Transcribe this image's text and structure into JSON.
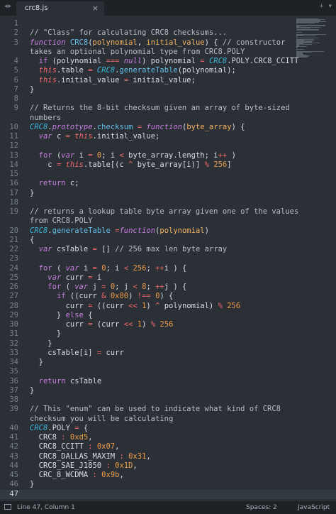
{
  "tab": {
    "title": "crc8.js",
    "close_glyph": "×"
  },
  "status": {
    "position": "Line 47, Column 1",
    "indent": "Spaces: 2",
    "syntax": "JavaScript"
  },
  "gutter": {
    "current_line": "47",
    "lines": [
      "1",
      "2",
      "3",
      "",
      "4",
      "5",
      "6",
      "7",
      "8",
      "9",
      "",
      "10",
      "11",
      "12",
      "13",
      "14",
      "15",
      "16",
      "17",
      "18",
      "19",
      "",
      "20",
      "21",
      "22",
      "23",
      "24",
      "25",
      "26",
      "27",
      "28",
      "29",
      "30",
      "31",
      "32",
      "33",
      "34",
      "35",
      "36",
      "37",
      "38",
      "39",
      "",
      "40",
      "41",
      "42",
      "43",
      "44",
      "45",
      "46",
      "47"
    ]
  },
  "code": {
    "lines": [
      [],
      [
        {
          "t": "// \"Class\" for calculating CRC8 checksums...",
          "c": "cmt"
        }
      ],
      [
        {
          "t": "function",
          "c": "kw"
        },
        {
          "t": " "
        },
        {
          "t": "CRC8",
          "c": "fn"
        },
        {
          "t": "("
        },
        {
          "t": "polynomial",
          "c": "prm"
        },
        {
          "t": ", "
        },
        {
          "t": "initial_value",
          "c": "prm"
        },
        {
          "t": ") { "
        },
        {
          "t": "// constructor",
          "c": "cmt"
        }
      ],
      [
        {
          "t": "takes an optional polynomial type from CRC8.POLY",
          "c": "cmt"
        }
      ],
      [
        {
          "t": "  "
        },
        {
          "t": "if",
          "c": "ctl"
        },
        {
          "t": " (polynomial "
        },
        {
          "t": "===",
          "c": "op"
        },
        {
          "t": " "
        },
        {
          "t": "null",
          "c": "kw"
        },
        {
          "t": ") polynomial "
        },
        {
          "t": "=",
          "c": "op"
        },
        {
          "t": " "
        },
        {
          "t": "CRC8",
          "c": "cls"
        },
        {
          "t": ".POLY.CRC8_CCITT"
        }
      ],
      [
        {
          "t": "  "
        },
        {
          "t": "this",
          "c": "this"
        },
        {
          "t": ".table "
        },
        {
          "t": "=",
          "c": "op"
        },
        {
          "t": " "
        },
        {
          "t": "CRC8",
          "c": "cls"
        },
        {
          "t": "."
        },
        {
          "t": "generateTable",
          "c": "fn"
        },
        {
          "t": "(polynomial);"
        }
      ],
      [
        {
          "t": "  "
        },
        {
          "t": "this",
          "c": "this"
        },
        {
          "t": ".initial_value "
        },
        {
          "t": "=",
          "c": "op"
        },
        {
          "t": " initial_value;"
        }
      ],
      [
        {
          "t": "}"
        }
      ],
      [],
      [
        {
          "t": "// Returns the 8-bit checksum given an array of byte-sized",
          "c": "cmt"
        }
      ],
      [
        {
          "t": "numbers",
          "c": "cmt"
        }
      ],
      [
        {
          "t": "CRC8",
          "c": "cls"
        },
        {
          "t": "."
        },
        {
          "t": "prototype",
          "c": "kw"
        },
        {
          "t": "."
        },
        {
          "t": "checksum",
          "c": "fn"
        },
        {
          "t": " "
        },
        {
          "t": "=",
          "c": "op"
        },
        {
          "t": " "
        },
        {
          "t": "function",
          "c": "kw"
        },
        {
          "t": "("
        },
        {
          "t": "byte_array",
          "c": "prm"
        },
        {
          "t": ") {"
        }
      ],
      [
        {
          "t": "  "
        },
        {
          "t": "var",
          "c": "kw"
        },
        {
          "t": " c "
        },
        {
          "t": "=",
          "c": "op"
        },
        {
          "t": " "
        },
        {
          "t": "this",
          "c": "this"
        },
        {
          "t": ".initial_value;"
        }
      ],
      [],
      [
        {
          "t": "  "
        },
        {
          "t": "for",
          "c": "ctl"
        },
        {
          "t": " ("
        },
        {
          "t": "var",
          "c": "kw"
        },
        {
          "t": " i "
        },
        {
          "t": "=",
          "c": "op"
        },
        {
          "t": " "
        },
        {
          "t": "0",
          "c": "num"
        },
        {
          "t": "; i "
        },
        {
          "t": "<",
          "c": "op"
        },
        {
          "t": " byte_array.length; i"
        },
        {
          "t": "++",
          "c": "op"
        },
        {
          "t": " )"
        }
      ],
      [
        {
          "t": "    c "
        },
        {
          "t": "=",
          "c": "op"
        },
        {
          "t": " "
        },
        {
          "t": "this",
          "c": "this"
        },
        {
          "t": ".table[(c "
        },
        {
          "t": "^",
          "c": "op"
        },
        {
          "t": " byte_array[i)] "
        },
        {
          "t": "%",
          "c": "op"
        },
        {
          "t": " "
        },
        {
          "t": "256",
          "c": "num"
        },
        {
          "t": "]"
        }
      ],
      [],
      [
        {
          "t": "  "
        },
        {
          "t": "return",
          "c": "ctl"
        },
        {
          "t": " c;"
        }
      ],
      [
        {
          "t": "}"
        }
      ],
      [],
      [
        {
          "t": "// returns a lookup table byte array given one of the values",
          "c": "cmt"
        }
      ],
      [
        {
          "t": "from CRC8.POLY",
          "c": "cmt"
        }
      ],
      [
        {
          "t": "CRC8",
          "c": "cls"
        },
        {
          "t": "."
        },
        {
          "t": "generateTable",
          "c": "fn"
        },
        {
          "t": " "
        },
        {
          "t": "=",
          "c": "op"
        },
        {
          "t": "function",
          "c": "kw"
        },
        {
          "t": "("
        },
        {
          "t": "polynomial",
          "c": "prm"
        },
        {
          "t": ")"
        }
      ],
      [
        {
          "t": "{"
        }
      ],
      [
        {
          "t": "  "
        },
        {
          "t": "var",
          "c": "kw"
        },
        {
          "t": " csTable "
        },
        {
          "t": "=",
          "c": "op"
        },
        {
          "t": " [] "
        },
        {
          "t": "// 256 max len byte array",
          "c": "cmt"
        }
      ],
      [],
      [
        {
          "t": "  "
        },
        {
          "t": "for",
          "c": "ctl"
        },
        {
          "t": " ( "
        },
        {
          "t": "var",
          "c": "kw"
        },
        {
          "t": " i "
        },
        {
          "t": "=",
          "c": "op"
        },
        {
          "t": " "
        },
        {
          "t": "0",
          "c": "num"
        },
        {
          "t": "; i "
        },
        {
          "t": "<",
          "c": "op"
        },
        {
          "t": " "
        },
        {
          "t": "256",
          "c": "num"
        },
        {
          "t": "; "
        },
        {
          "t": "++",
          "c": "op"
        },
        {
          "t": "i ) {"
        }
      ],
      [
        {
          "t": "    "
        },
        {
          "t": "var",
          "c": "kw"
        },
        {
          "t": " curr "
        },
        {
          "t": "=",
          "c": "op"
        },
        {
          "t": " i"
        }
      ],
      [
        {
          "t": "    "
        },
        {
          "t": "for",
          "c": "ctl"
        },
        {
          "t": " ( "
        },
        {
          "t": "var",
          "c": "kw"
        },
        {
          "t": " j "
        },
        {
          "t": "=",
          "c": "op"
        },
        {
          "t": " "
        },
        {
          "t": "0",
          "c": "num"
        },
        {
          "t": "; j "
        },
        {
          "t": "<",
          "c": "op"
        },
        {
          "t": " "
        },
        {
          "t": "8",
          "c": "num"
        },
        {
          "t": "; "
        },
        {
          "t": "++",
          "c": "op"
        },
        {
          "t": "j ) {"
        }
      ],
      [
        {
          "t": "      "
        },
        {
          "t": "if",
          "c": "ctl"
        },
        {
          "t": " ((curr "
        },
        {
          "t": "&",
          "c": "op"
        },
        {
          "t": " "
        },
        {
          "t": "0x80",
          "c": "num"
        },
        {
          "t": ") "
        },
        {
          "t": "!==",
          "c": "op"
        },
        {
          "t": " "
        },
        {
          "t": "0",
          "c": "num"
        },
        {
          "t": ") {"
        }
      ],
      [
        {
          "t": "        curr "
        },
        {
          "t": "=",
          "c": "op"
        },
        {
          "t": " ((curr "
        },
        {
          "t": "<<",
          "c": "op"
        },
        {
          "t": " "
        },
        {
          "t": "1",
          "c": "num"
        },
        {
          "t": ") "
        },
        {
          "t": "^",
          "c": "op"
        },
        {
          "t": " polynomial) "
        },
        {
          "t": "%",
          "c": "op"
        },
        {
          "t": " "
        },
        {
          "t": "256",
          "c": "num"
        }
      ],
      [
        {
          "t": "      } "
        },
        {
          "t": "else",
          "c": "ctl"
        },
        {
          "t": " {"
        }
      ],
      [
        {
          "t": "        curr "
        },
        {
          "t": "=",
          "c": "op"
        },
        {
          "t": " (curr "
        },
        {
          "t": "<<",
          "c": "op"
        },
        {
          "t": " "
        },
        {
          "t": "1",
          "c": "num"
        },
        {
          "t": ") "
        },
        {
          "t": "%",
          "c": "op"
        },
        {
          "t": " "
        },
        {
          "t": "256",
          "c": "num"
        }
      ],
      [
        {
          "t": "      }"
        }
      ],
      [
        {
          "t": "    }"
        }
      ],
      [
        {
          "t": "    csTable[i] "
        },
        {
          "t": "=",
          "c": "op"
        },
        {
          "t": " curr"
        }
      ],
      [
        {
          "t": "  }"
        }
      ],
      [],
      [
        {
          "t": "  "
        },
        {
          "t": "return",
          "c": "ctl"
        },
        {
          "t": " csTable"
        }
      ],
      [
        {
          "t": "}"
        }
      ],
      [],
      [
        {
          "t": "// This \"enum\" can be used to indicate what kind of CRC8",
          "c": "cmt"
        }
      ],
      [
        {
          "t": "checksum you will be calculating",
          "c": "cmt"
        }
      ],
      [
        {
          "t": "CRC8",
          "c": "cls"
        },
        {
          "t": ".POLY "
        },
        {
          "t": "=",
          "c": "op"
        },
        {
          "t": " {"
        }
      ],
      [
        {
          "t": "  CRC8 "
        },
        {
          "t": ":",
          "c": "op"
        },
        {
          "t": " "
        },
        {
          "t": "0xd5",
          "c": "num"
        },
        {
          "t": ","
        }
      ],
      [
        {
          "t": "  CRC8_CCITT "
        },
        {
          "t": ":",
          "c": "op"
        },
        {
          "t": " "
        },
        {
          "t": "0x07",
          "c": "num"
        },
        {
          "t": ","
        }
      ],
      [
        {
          "t": "  CRC8_DALLAS_MAXIM "
        },
        {
          "t": ":",
          "c": "op"
        },
        {
          "t": " "
        },
        {
          "t": "0x31",
          "c": "num"
        },
        {
          "t": ","
        }
      ],
      [
        {
          "t": "  CRC8_SAE_J1850 "
        },
        {
          "t": ":",
          "c": "op"
        },
        {
          "t": " "
        },
        {
          "t": "0x1D",
          "c": "num"
        },
        {
          "t": ","
        }
      ],
      [
        {
          "t": "  CRC_8_WCDMA "
        },
        {
          "t": ":",
          "c": "op"
        },
        {
          "t": " "
        },
        {
          "t": "0x9b",
          "c": "num"
        },
        {
          "t": ","
        }
      ],
      [
        {
          "t": "}"
        }
      ],
      []
    ]
  }
}
